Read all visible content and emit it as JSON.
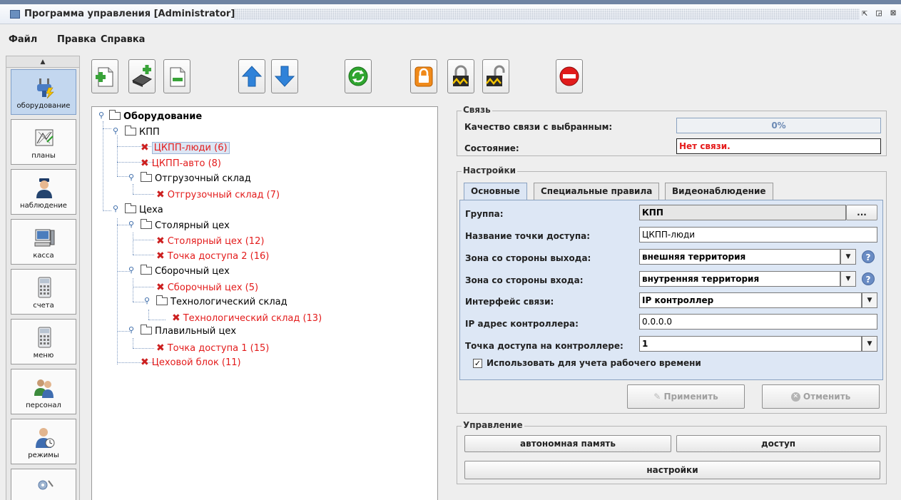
{
  "window": {
    "title": "Программа управления [Administrator]",
    "controls": [
      "minimize-icon",
      "maximize-icon",
      "close-icon"
    ]
  },
  "menubar": {
    "items": [
      "Файл",
      "Правка",
      "Справка"
    ]
  },
  "leftnav": {
    "items": [
      {
        "label": "оборудование",
        "icon": "plug-icon",
        "active": true
      },
      {
        "label": "планы",
        "icon": "plan-drawing-icon",
        "active": false
      },
      {
        "label": "наблюдение",
        "icon": "guard-icon",
        "active": false
      },
      {
        "label": "касса",
        "icon": "computer-icon",
        "active": false
      },
      {
        "label": "счета",
        "icon": "calculator-icon",
        "active": false
      },
      {
        "label": "меню",
        "icon": "calculator-icon",
        "active": false
      },
      {
        "label": "персонал",
        "icon": "people-icon",
        "active": false
      },
      {
        "label": "режимы",
        "icon": "user-clock-icon",
        "active": false
      }
    ]
  },
  "toolbar": {
    "buttons": [
      "add-folder-icon",
      "add-device-icon",
      "remove-icon",
      "arrow-up-icon",
      "arrow-down-icon",
      "refresh-icon",
      "lock-orange-icon",
      "lock-closed-icon",
      "lock-open-icon",
      "stop-icon"
    ]
  },
  "tree": {
    "rows": [
      {
        "text": "Оборудование",
        "kind": "folder",
        "bold": true
      },
      {
        "text": "КПП",
        "kind": "folder"
      },
      {
        "text": "ЦКПП-люди (6)",
        "kind": "device",
        "selected": true
      },
      {
        "text": "ЦКПП-авто (8)",
        "kind": "device"
      },
      {
        "text": "Отгрузочный склад",
        "kind": "folder"
      },
      {
        "text": "Отгрузочный склад (7)",
        "kind": "device"
      },
      {
        "text": "Цеха",
        "kind": "folder"
      },
      {
        "text": "Столярный цех",
        "kind": "folder"
      },
      {
        "text": "Столярный цех (12)",
        "kind": "device"
      },
      {
        "text": "Точка доступа 2 (16)",
        "kind": "device"
      },
      {
        "text": "Сборочный цех",
        "kind": "folder"
      },
      {
        "text": "Сборочный цех (5)",
        "kind": "device"
      },
      {
        "text": "Технологический склад",
        "kind": "folder"
      },
      {
        "text": "Технологический склад (13)",
        "kind": "device"
      },
      {
        "text": "Плавильный цех",
        "kind": "folder"
      },
      {
        "text": "Точка доступа 1 (15)",
        "kind": "device"
      },
      {
        "text": "Цеховой блок (11)",
        "kind": "device"
      }
    ]
  },
  "connection": {
    "title": "Связь",
    "quality_label": "Качество связи с выбранным:",
    "quality_value": "0%",
    "quality_fraction": 0,
    "state_label": "Состояние:",
    "state_value": "Нет связи."
  },
  "settings": {
    "title": "Настройки",
    "tabs": [
      "Основные",
      "Специальные правила",
      "Видеонаблюдение"
    ],
    "group_label": "Группа:",
    "group_value": "КПП",
    "group_browse": "...",
    "name_label": "Название точки доступа:",
    "name_value": "ЦКПП-люди",
    "exit_zone_label": "Зона со стороны выхода:",
    "exit_zone_value": "внешняя территория",
    "entry_zone_label": "Зона со стороны входа:",
    "entry_zone_value": "внутренняя территория",
    "interface_label": "Интерфейс связи:",
    "interface_value": "IP контроллер",
    "ip_label": "IP адрес контроллера:",
    "ip_value": "0.0.0.0",
    "controller_point_label": "Точка доступа на контроллере:",
    "controller_point_value": "1",
    "worktime_checkbox_label": "Использовать для учета рабочего времени",
    "worktime_checked": true,
    "help_symbol": "?",
    "apply_label": "Применить",
    "cancel_label": "Отменить"
  },
  "control": {
    "title": "Управление",
    "autonomous_label": "автономная память",
    "access_label": "доступ",
    "settings_label": "настройки"
  }
}
